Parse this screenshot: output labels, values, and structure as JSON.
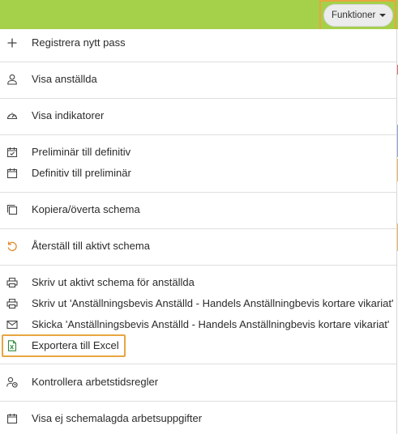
{
  "toolbar": {
    "functions_label": "Funktioner",
    "accent_color": "#a4d04a",
    "highlight_color": "#e8a640"
  },
  "menu": {
    "items": [
      {
        "label": "Registrera nytt pass",
        "icon": "plus-icon"
      },
      {
        "label": "Visa anställda",
        "icon": "user-icon"
      },
      {
        "label": "Visa indikatorer",
        "icon": "gauge-icon"
      },
      {
        "label": "Preliminär till definitiv",
        "icon": "calendar-check-icon"
      },
      {
        "label": "Definitiv till preliminär",
        "icon": "calendar-icon"
      },
      {
        "label": "Kopiera/överta schema",
        "icon": "copy-icon"
      },
      {
        "label": "Återställ till aktivt schema",
        "icon": "undo-icon"
      },
      {
        "label": "Skriv ut aktivt schema för anställda",
        "icon": "printer-icon"
      },
      {
        "label": "Skriv ut 'Anställningsbevis Anställd - Handels Anställningbevis kortare vikariat'",
        "icon": "printer-icon"
      },
      {
        "label": "Skicka 'Anställningsbevis Anställd - Handels Anställningbevis kortare vikariat'",
        "icon": "envelope-icon"
      },
      {
        "label": "Exportera till Excel",
        "icon": "excel-file-icon"
      },
      {
        "label": "Kontrollera arbetstidsregler",
        "icon": "user-clock-icon"
      },
      {
        "label": "Visa ej schemalagda arbetsuppgifter",
        "icon": "calendar-icon"
      }
    ]
  }
}
